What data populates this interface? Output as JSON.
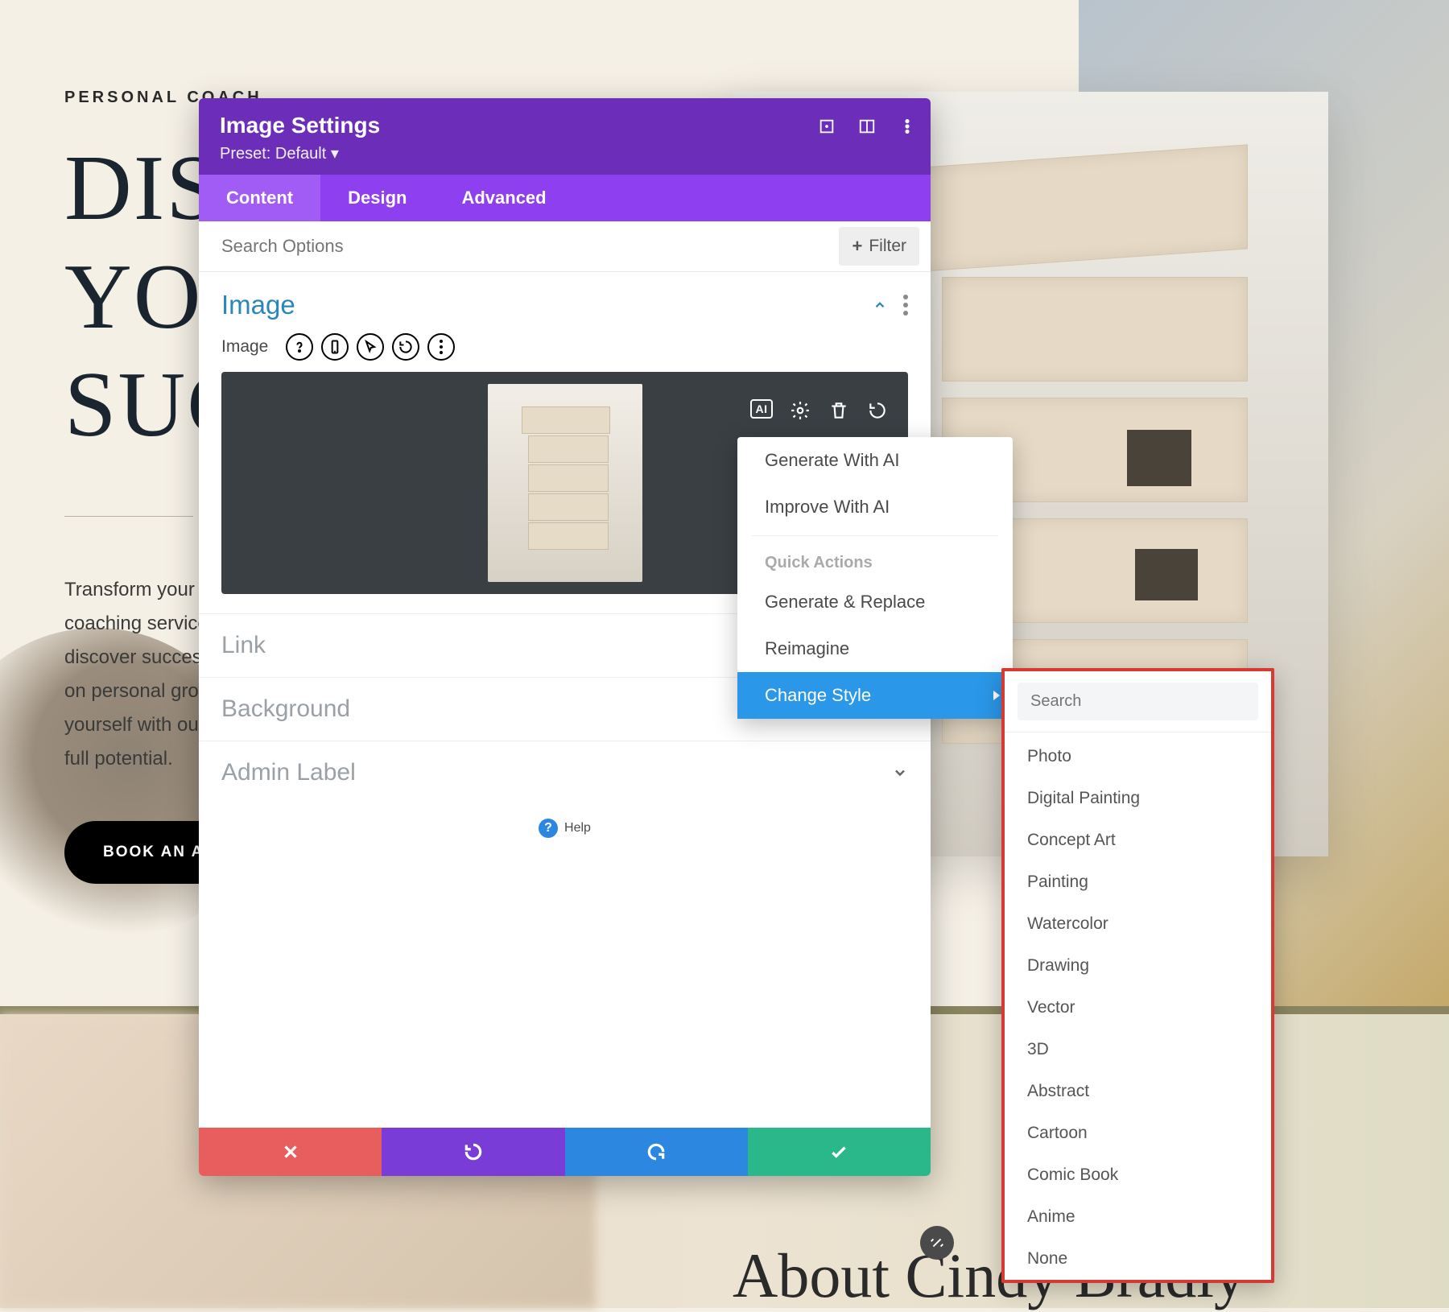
{
  "hero": {
    "eyebrow": "PERSONAL COACH",
    "title": "DISCOVER YOUR SUCCESS",
    "body": "Transform your life with our personal coaching services. Achieve your goals and discover success. Our philosophy centers on personal growth and balance. Empower yourself with our guidance and unlock your full potential.",
    "button": "BOOK AN APPOINTMENT"
  },
  "about_heading": "About Cindy Bradly",
  "modal": {
    "title": "Image Settings",
    "preset": "Preset: Default ▾",
    "tabs": {
      "content": "Content",
      "design": "Design",
      "advanced": "Advanced"
    },
    "search_placeholder": "Search Options",
    "filter_label": "Filter",
    "section_image": "Image",
    "field_image": "Image",
    "collapsed": {
      "link": "Link",
      "background": "Background",
      "admin_label": "Admin Label"
    },
    "help": "Help"
  },
  "ai_menu": {
    "generate": "Generate With AI",
    "improve": "Improve With AI",
    "quick_header": "Quick Actions",
    "generate_replace": "Generate & Replace",
    "reimagine": "Reimagine",
    "change_style": "Change Style"
  },
  "style_menu": {
    "search_placeholder": "Search",
    "items": [
      "Photo",
      "Digital Painting",
      "Concept Art",
      "Painting",
      "Watercolor",
      "Drawing",
      "Vector",
      "3D",
      "Abstract",
      "Cartoon",
      "Comic Book",
      "Anime",
      "None"
    ]
  }
}
